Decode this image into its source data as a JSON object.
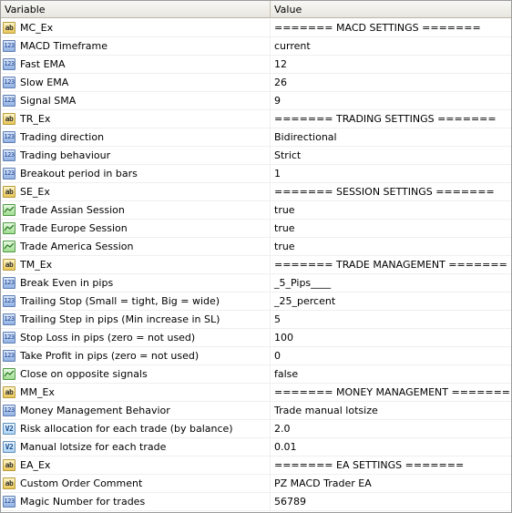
{
  "header": {
    "variable": "Variable",
    "value": "Value"
  },
  "rows": [
    {
      "type": "ab",
      "name": "MC_Ex",
      "value": "======= MACD SETTINGS ======="
    },
    {
      "type": "123",
      "name": "MACD Timeframe",
      "value": "current"
    },
    {
      "type": "123",
      "name": "Fast EMA",
      "value": "12"
    },
    {
      "type": "123",
      "name": "Slow EMA",
      "value": "26"
    },
    {
      "type": "123",
      "name": "Signal SMA",
      "value": "9"
    },
    {
      "type": "ab",
      "name": "TR_Ex",
      "value": "======= TRADING SETTINGS ======="
    },
    {
      "type": "123",
      "name": "Trading direction",
      "value": "Bidirectional"
    },
    {
      "type": "123",
      "name": "Trading behaviour",
      "value": "Strict"
    },
    {
      "type": "123",
      "name": "Breakout period in bars",
      "value": "1"
    },
    {
      "type": "ab",
      "name": "SE_Ex",
      "value": "======= SESSION SETTINGS ======="
    },
    {
      "type": "bool",
      "name": "Trade Assian Session",
      "value": "true"
    },
    {
      "type": "bool",
      "name": "Trade Europe Session",
      "value": "true"
    },
    {
      "type": "bool",
      "name": "Trade America Session",
      "value": "true"
    },
    {
      "type": "ab",
      "name": "TM_Ex",
      "value": "======= TRADE MANAGEMENT ======="
    },
    {
      "type": "123",
      "name": "Break Even in pips",
      "value": "_5_Pips____"
    },
    {
      "type": "123",
      "name": "Trailing Stop (Small = tight, Big = wide)",
      "value": "_25_percent"
    },
    {
      "type": "123",
      "name": "Trailing Step in pips (Min increase in SL)",
      "value": "5"
    },
    {
      "type": "123",
      "name": "Stop Loss in pips (zero = not used)",
      "value": "100"
    },
    {
      "type": "123",
      "name": "Take Profit in pips (zero = not used)",
      "value": "0"
    },
    {
      "type": "bool",
      "name": "Close on opposite signals",
      "value": "false"
    },
    {
      "type": "ab",
      "name": "MM_Ex",
      "value": "======= MONEY MANAGEMENT ======="
    },
    {
      "type": "123",
      "name": "Money Management Behavior",
      "value": "Trade manual lotsize"
    },
    {
      "type": "v2",
      "name": "Risk allocation for each trade (by balance)",
      "value": "2.0"
    },
    {
      "type": "v2",
      "name": "Manual lotsize for each trade",
      "value": "0.01"
    },
    {
      "type": "ab",
      "name": "EA_Ex",
      "value": "======= EA SETTINGS ======="
    },
    {
      "type": "ab",
      "name": "Custom Order Comment",
      "value": "PZ MACD Trader EA"
    },
    {
      "type": "123",
      "name": "Magic Number for trades",
      "value": "56789"
    }
  ],
  "icons": {
    "ab": {
      "name": "string-type-icon",
      "glyph": "ab"
    },
    "123": {
      "name": "integer-type-icon",
      "glyph": "123"
    },
    "v2": {
      "name": "double-type-icon",
      "glyph": "V2"
    },
    "bool": {
      "name": "boolean-type-icon",
      "glyph": ""
    }
  }
}
